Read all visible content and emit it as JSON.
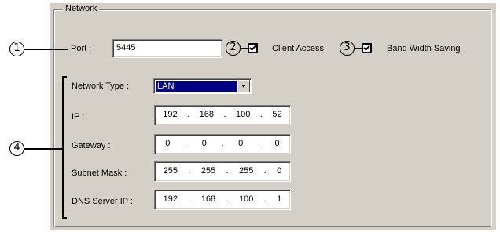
{
  "group": {
    "title": "Network"
  },
  "port": {
    "label": "Port :",
    "value": "5445"
  },
  "client_access": {
    "label": "Client Access",
    "checked": true
  },
  "bandwidth_saving": {
    "label": "Band Width Saving",
    "checked": true
  },
  "network_type": {
    "label": "Network Type :",
    "value": "LAN"
  },
  "ip": {
    "label": "IP :",
    "octets": [
      "192",
      "168",
      "100",
      "52"
    ]
  },
  "gateway": {
    "label": "Gateway :",
    "octets": [
      "0",
      "0",
      "0",
      "0"
    ]
  },
  "subnet": {
    "label": "Subnet Mask :",
    "octets": [
      "255",
      "255",
      "255",
      "0"
    ]
  },
  "dns": {
    "label": "DNS Server IP :",
    "octets": [
      "192",
      "168",
      "100",
      "1"
    ]
  },
  "callouts": [
    "1",
    "2",
    "3",
    "4"
  ]
}
